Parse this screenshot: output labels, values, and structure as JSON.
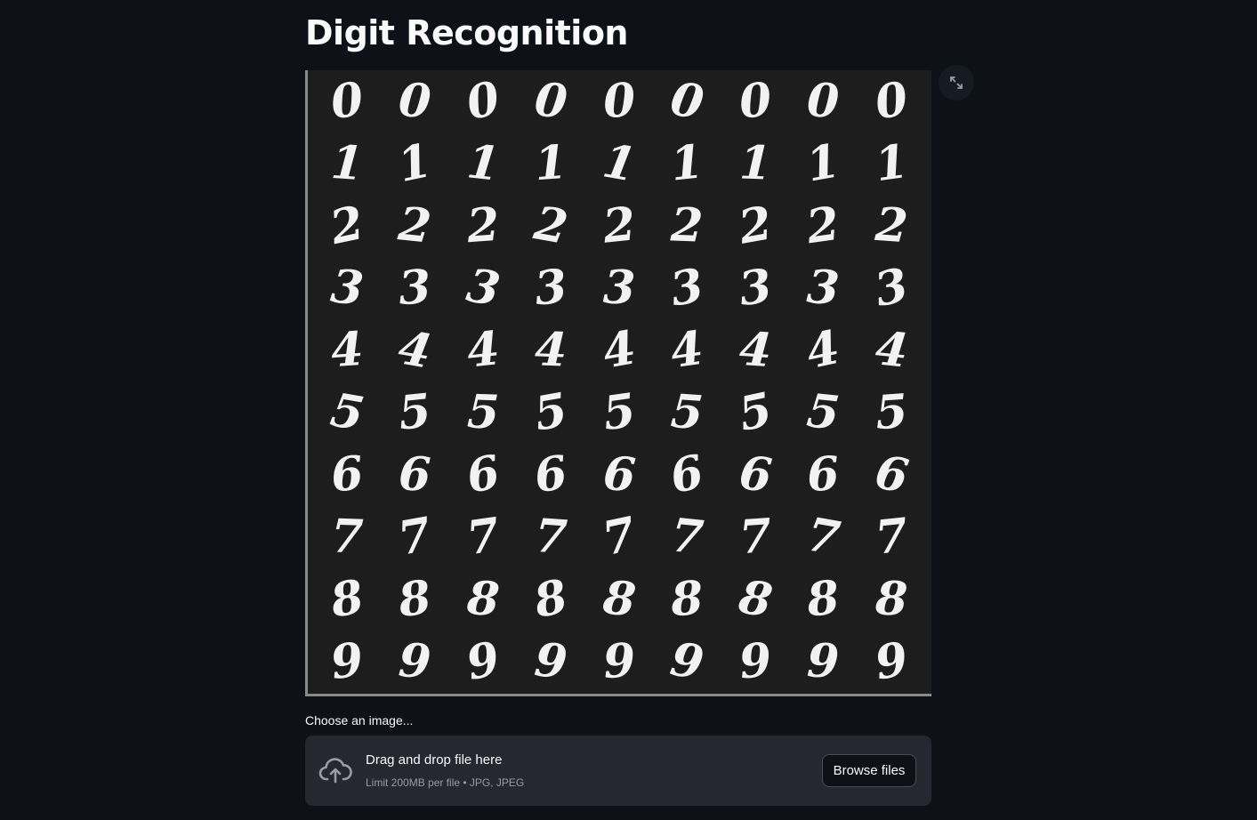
{
  "page": {
    "title": "Digit Recognition"
  },
  "image": {
    "alt": "",
    "rows": [
      [
        "0",
        "0",
        "0",
        "0",
        "0",
        "0",
        "0",
        "0",
        "0"
      ],
      [
        "1",
        "1",
        "1",
        "1",
        "1",
        "1",
        "1",
        "1",
        "1"
      ],
      [
        "2",
        "2",
        "2",
        "2",
        "2",
        "2",
        "2",
        "2",
        "2"
      ],
      [
        "3",
        "3",
        "3",
        "3",
        "3",
        "3",
        "3",
        "3",
        "3"
      ],
      [
        "4",
        "4",
        "4",
        "4",
        "4",
        "4",
        "4",
        "4",
        "4"
      ],
      [
        "5",
        "5",
        "5",
        "5",
        "5",
        "5",
        "5",
        "5",
        "5"
      ],
      [
        "6",
        "6",
        "6",
        "6",
        "6",
        "6",
        "6",
        "6",
        "6"
      ],
      [
        "7",
        "7",
        "7",
        "7",
        "7",
        "7",
        "7",
        "7",
        "7"
      ],
      [
        "8",
        "8",
        "8",
        "8",
        "8",
        "8",
        "8",
        "8",
        "8"
      ],
      [
        "9",
        "9",
        "9",
        "9",
        "9",
        "9",
        "9",
        "9",
        "9"
      ]
    ],
    "fullscreen_icon": "expand-arrows-icon"
  },
  "uploader": {
    "label": "Choose an image...",
    "dropzone_title": "Drag and drop file here",
    "dropzone_subtitle": "Limit 200MB per file • JPG, JPEG",
    "browse_label": "Browse files",
    "icon": "cloud-upload-icon"
  },
  "colors": {
    "background": "#0e1117",
    "dropzone": "#262730",
    "text": "#fafafa",
    "muted": "#9a9ca5"
  }
}
